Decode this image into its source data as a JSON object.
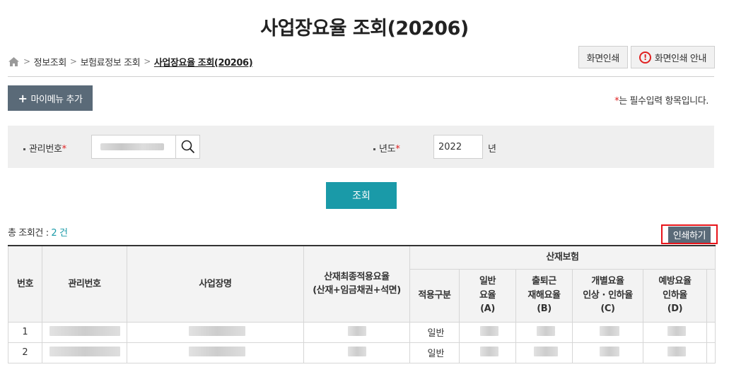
{
  "title": "사업장요율 조회(20206)",
  "breadcrumb": [
    "정보조회",
    "보험료정보 조회",
    "사업장요율 조회(20206)"
  ],
  "top_buttons": {
    "print_screen": "화면인쇄",
    "print_guide": "화면인쇄 안내"
  },
  "mymenu_add": "마이메뉴 추가",
  "required_note": {
    "star": "*",
    "text": "는 필수입력 항목입니다."
  },
  "search": {
    "mgmt_label": "관리번호",
    "mgmt_value": "",
    "year_label": "년도",
    "year_value": "2022",
    "year_unit": "년",
    "star": "*"
  },
  "query_button": "조회",
  "total": {
    "prefix": "총 조회건 : ",
    "count": "2 건"
  },
  "print_button": "인쇄하기",
  "table": {
    "headers": {
      "no": "번호",
      "mgmt_no": "관리번호",
      "biz_name": "사업장명",
      "final_rate": "산재최종적용요율\n(산재+임금채권+석면)",
      "group": "산재보험",
      "apply_type": "적용구분",
      "general_rate": "일반\n요율\n(A)",
      "commute_rate": "출퇴근\n재해요율\n(B)",
      "individual_rate": "개별요율\n인상 · 인하율\n(C)",
      "prevent_rate": "예방요율\n인하율\n(D)"
    },
    "rows": [
      {
        "no": "1",
        "apply_type": "일반"
      },
      {
        "no": "2",
        "apply_type": "일반"
      }
    ]
  }
}
